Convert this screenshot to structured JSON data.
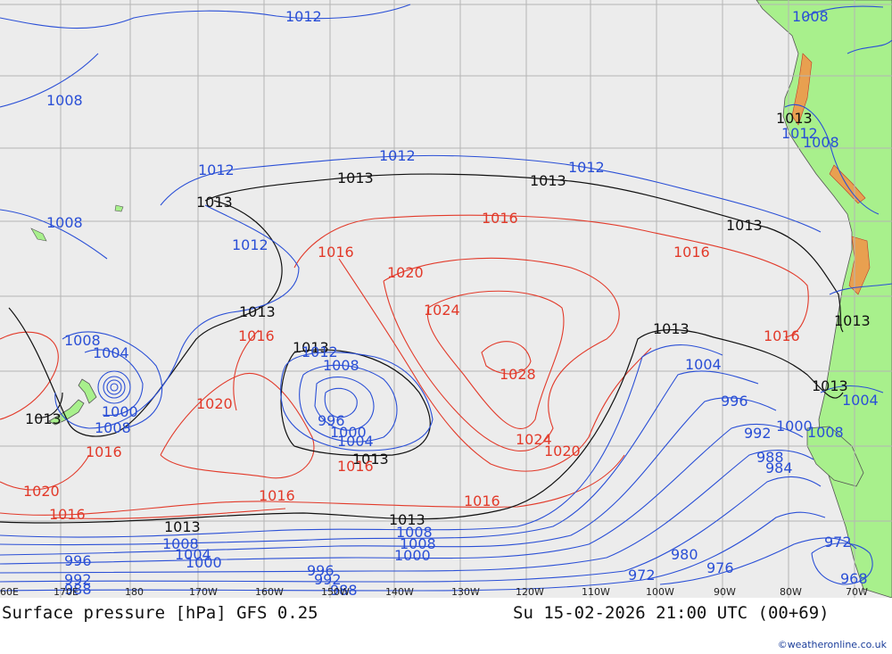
{
  "title_left": "Surface pressure [hPa] GFS 0.25",
  "title_right": "Su 15-02-2026 21:00 UTC (00+69)",
  "credit": "©weatheronline.co.uk",
  "colors": {
    "ocean": "#ececec",
    "land": "#a8f08c",
    "isobar_low": "#2a4fd6",
    "isobar_high": "#e23a2a",
    "isobar_ref": "#111111",
    "grid": "#b5b5b5"
  },
  "lon_ticks": [
    "60E",
    "170E",
    "180",
    "170W",
    "160W",
    "150W",
    "140W",
    "130W",
    "120W",
    "110W",
    "100W",
    "90W",
    "80W",
    "70W"
  ],
  "labels": {
    "black": [
      "1013",
      "1013",
      "1013",
      "1013",
      "1013",
      "1013",
      "1013",
      "1013",
      "1013",
      "1013",
      "1013",
      "1013",
      "1013",
      "1013"
    ],
    "blue": [
      "1012",
      "1008",
      "1012",
      "1012",
      "1012",
      "1008",
      "1012",
      "1012",
      "1008",
      "1004",
      "1008",
      "1000",
      "1008",
      "996",
      "1000",
      "1004",
      "1008",
      "1004",
      "996",
      "1000",
      "992",
      "988",
      "984",
      "1008",
      "1004",
      "1000",
      "996",
      "992",
      "988",
      "980",
      "976",
      "972",
      "972",
      "968",
      "1008",
      "1004",
      "1008",
      "1000",
      "996",
      "992",
      "988",
      "1008",
      "1012",
      "1008"
    ],
    "red": [
      "1016",
      "1016",
      "1016",
      "1020",
      "1024",
      "1028",
      "1024",
      "1020",
      "1016",
      "1016",
      "1016",
      "1020",
      "1016",
      "1020",
      "1016",
      "1016",
      "1016"
    ]
  }
}
